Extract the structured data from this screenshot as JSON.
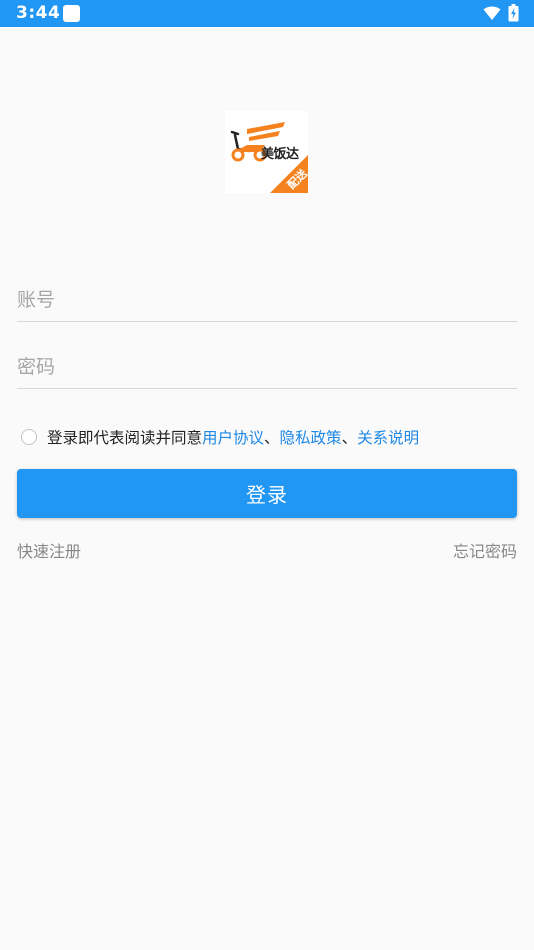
{
  "status_bar": {
    "time": "3:44",
    "background": "#2196f3",
    "icons": [
      "notification-icon",
      "wifi-icon",
      "battery-charging-icon"
    ]
  },
  "logo": {
    "brand_text": "美饭达",
    "ribbon_text": "配送",
    "colors": {
      "ribbon": "#f5821f",
      "scooter": "#f5821f"
    }
  },
  "form": {
    "account_placeholder": "账号",
    "password_placeholder": "密码"
  },
  "agreement": {
    "prefix": "登录即代表阅读并同意",
    "link_user": "用户协议",
    "sep1": "、",
    "link_privacy": "隐私政策",
    "sep2": "、",
    "link_relation": "关系说明",
    "checked": false,
    "link_color": "#1e88e5"
  },
  "login_button": {
    "label": "登录",
    "color": "#2196f3"
  },
  "links": {
    "register": "快速注册",
    "forgot": "忘记密码"
  }
}
